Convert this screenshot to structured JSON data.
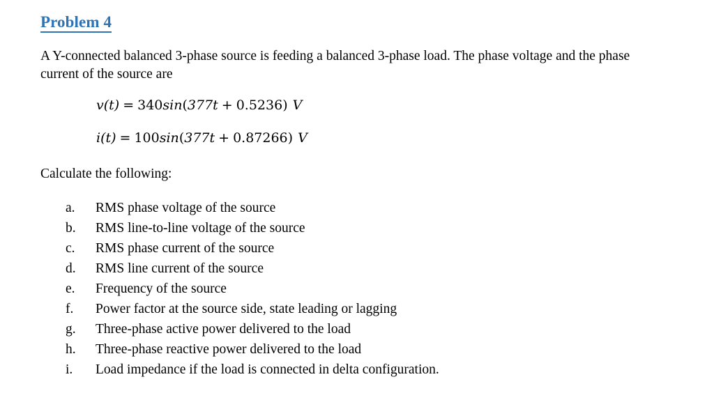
{
  "document": {
    "heading": "Problem 4",
    "heading_color": "#2E74B5",
    "background_color": "#FFFFFF",
    "text_color": "#000000",
    "intro_paragraph": "A Y-connected balanced 3-phase source is feeding a balanced 3-phase load. The phase voltage and the phase current of the source are",
    "calculate_prompt": "Calculate the following:",
    "equations": [
      {
        "lhs": "v(t)",
        "equals": "=",
        "amplitude": "340",
        "function": "sin",
        "open_paren": "(",
        "angular_term": "377t",
        "plus": "+",
        "phase": "0.5236",
        "close_paren": ")",
        "unit": "V",
        "plain": "v(t) = 340sin(377t + 0.5236) V"
      },
      {
        "lhs": "i(t)",
        "equals": "=",
        "amplitude": "100",
        "function": "sin",
        "open_paren": "(",
        "angular_term": "377t",
        "plus": "+",
        "phase": "0.87266",
        "close_paren": ")",
        "unit": "V",
        "plain": "i(t) = 100sin(377t + 0.87266) V"
      }
    ],
    "tasks": [
      {
        "marker": "a.",
        "text": "RMS phase voltage of the source"
      },
      {
        "marker": "b.",
        "text": "RMS line-to-line voltage of the source"
      },
      {
        "marker": "c.",
        "text": "RMS phase current of the source"
      },
      {
        "marker": "d.",
        "text": "RMS line current of the source"
      },
      {
        "marker": "e.",
        "text": "Frequency of the source"
      },
      {
        "marker": "f.",
        "text": "Power factor at the source side, state leading or lagging"
      },
      {
        "marker": "g.",
        "text": "Three-phase active power delivered to the load"
      },
      {
        "marker": "h.",
        "text": "Three-phase reactive power delivered to the load"
      },
      {
        "marker": "i.",
        "text": "Load impedance if the load is connected in delta configuration."
      }
    ]
  }
}
